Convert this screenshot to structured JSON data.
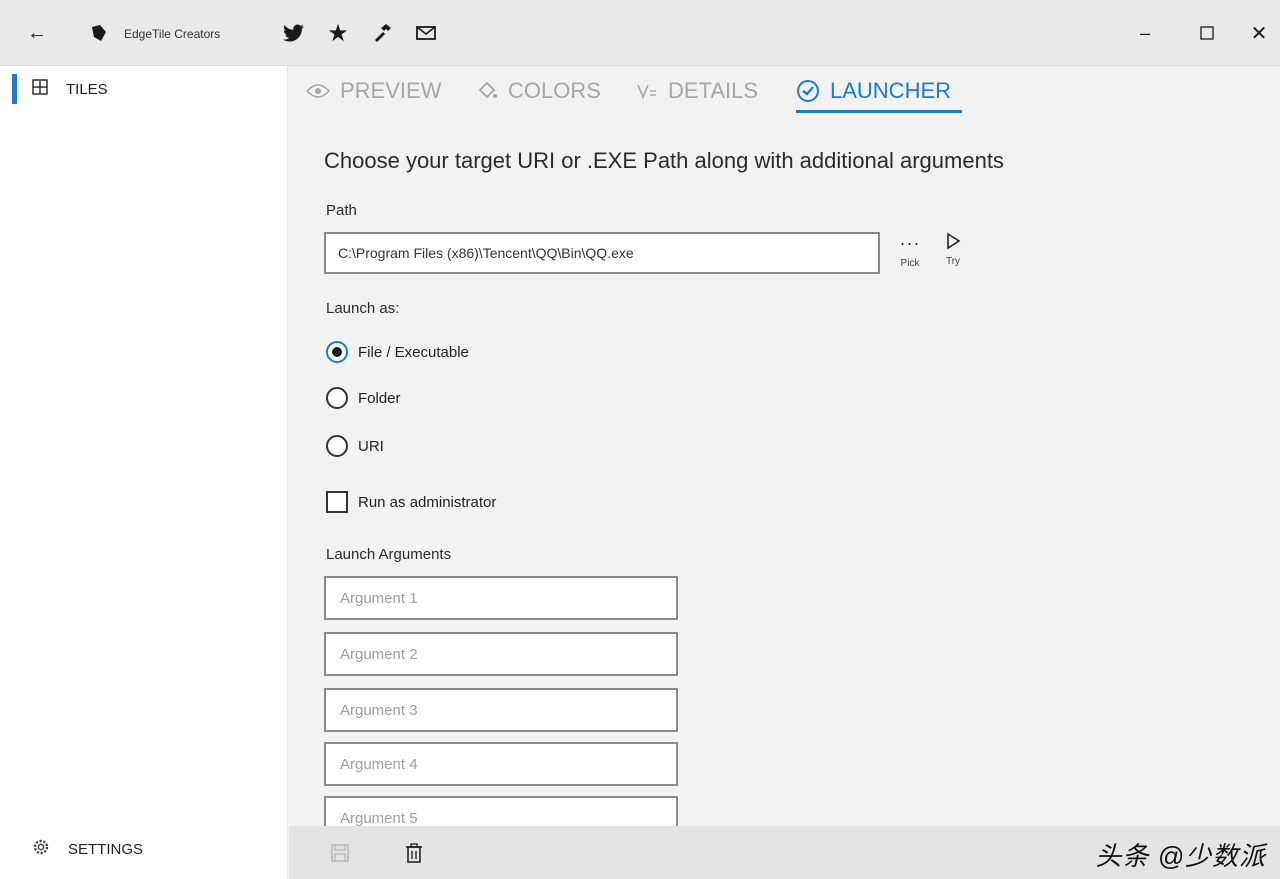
{
  "titlebar": {
    "app_title": "EdgeTile Creators",
    "back_icon": "back-arrow-icon",
    "icons": [
      "twitter-icon",
      "star-icon",
      "hammer-icon",
      "mail-icon"
    ],
    "min_glyph": "–",
    "close_glyph": "✕"
  },
  "sidebar": {
    "accent_color": "#1a7ad4",
    "tiles_label": "TILES",
    "settings_label": "SETTINGS"
  },
  "tabs": [
    {
      "label": "PREVIEW",
      "icon": "eye-icon",
      "active": false
    },
    {
      "label": "COLORS",
      "icon": "paint-bucket-icon",
      "active": false
    },
    {
      "label": "DETAILS",
      "icon": "details-icon",
      "active": false
    },
    {
      "label": "LAUNCHER",
      "icon": "launcher-check-icon",
      "active": true
    }
  ],
  "main": {
    "heading": "Choose your target URI or .EXE Path along with additional arguments",
    "path_label": "Path",
    "path_value": "C:\\Program Files (x86)\\Tencent\\QQ\\Bin\\QQ.exe",
    "pick_glyph": "···",
    "pick_label": "Pick",
    "try_label": "Try",
    "launch_as_label": "Launch as:",
    "launch_options": [
      {
        "label": "File / Executable",
        "checked": true
      },
      {
        "label": "Folder",
        "checked": false
      },
      {
        "label": "URI",
        "checked": false
      }
    ],
    "run_as_admin_label": "Run as administrator",
    "run_as_admin_checked": false,
    "args_label": "Launch Arguments",
    "args_placeholders": [
      "Argument 1",
      "Argument 2",
      "Argument 3",
      "Argument 4",
      "Argument 5"
    ]
  },
  "cmdbar": {
    "watermark": "头条 @少数派"
  }
}
